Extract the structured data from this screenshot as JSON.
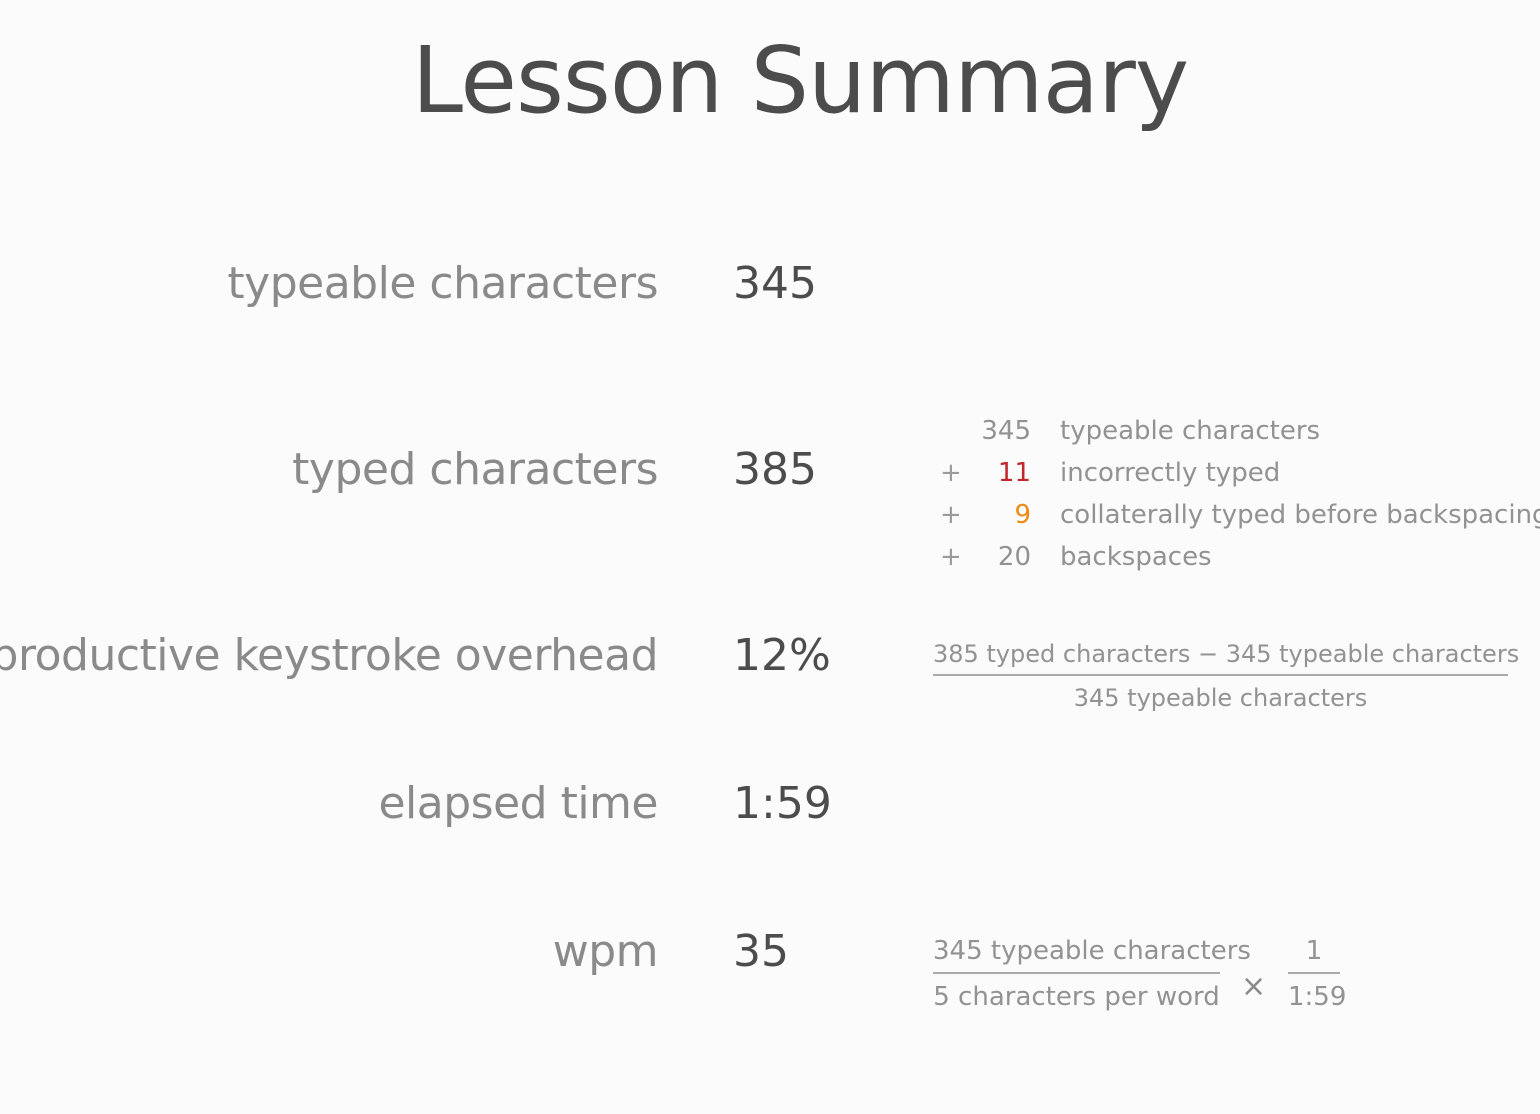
{
  "title": "Lesson Summary",
  "rows": {
    "typeable": {
      "label": "typeable characters",
      "value": "345"
    },
    "typed": {
      "label": "typed characters",
      "value": "385"
    },
    "overhead": {
      "label": "unproductive keystroke overhead",
      "value": "12%"
    },
    "elapsed": {
      "label": "elapsed time",
      "value": "1:59"
    },
    "wpm": {
      "label": "wpm",
      "value": "35"
    }
  },
  "typed_breakdown": [
    {
      "op": "",
      "num": "345",
      "desc": "typeable characters"
    },
    {
      "op": "+",
      "num": "11",
      "desc": "incorrectly typed"
    },
    {
      "op": "+",
      "num": "9",
      "desc": "collaterally typed before backspacing"
    },
    {
      "op": "+",
      "num": "20",
      "desc": "backspaces"
    }
  ],
  "overhead_formula": {
    "numerator": "385 typed characters − 345 typeable characters",
    "denominator": "345 typeable characters"
  },
  "wpm_formula": {
    "left_numerator": "345 typeable characters",
    "left_denominator": "5 characters per word",
    "operator": "×",
    "right_numerator": "1",
    "right_denominator": "1:59"
  },
  "colors": {
    "error": "#c1272d",
    "collateral": "#ee8a12"
  }
}
